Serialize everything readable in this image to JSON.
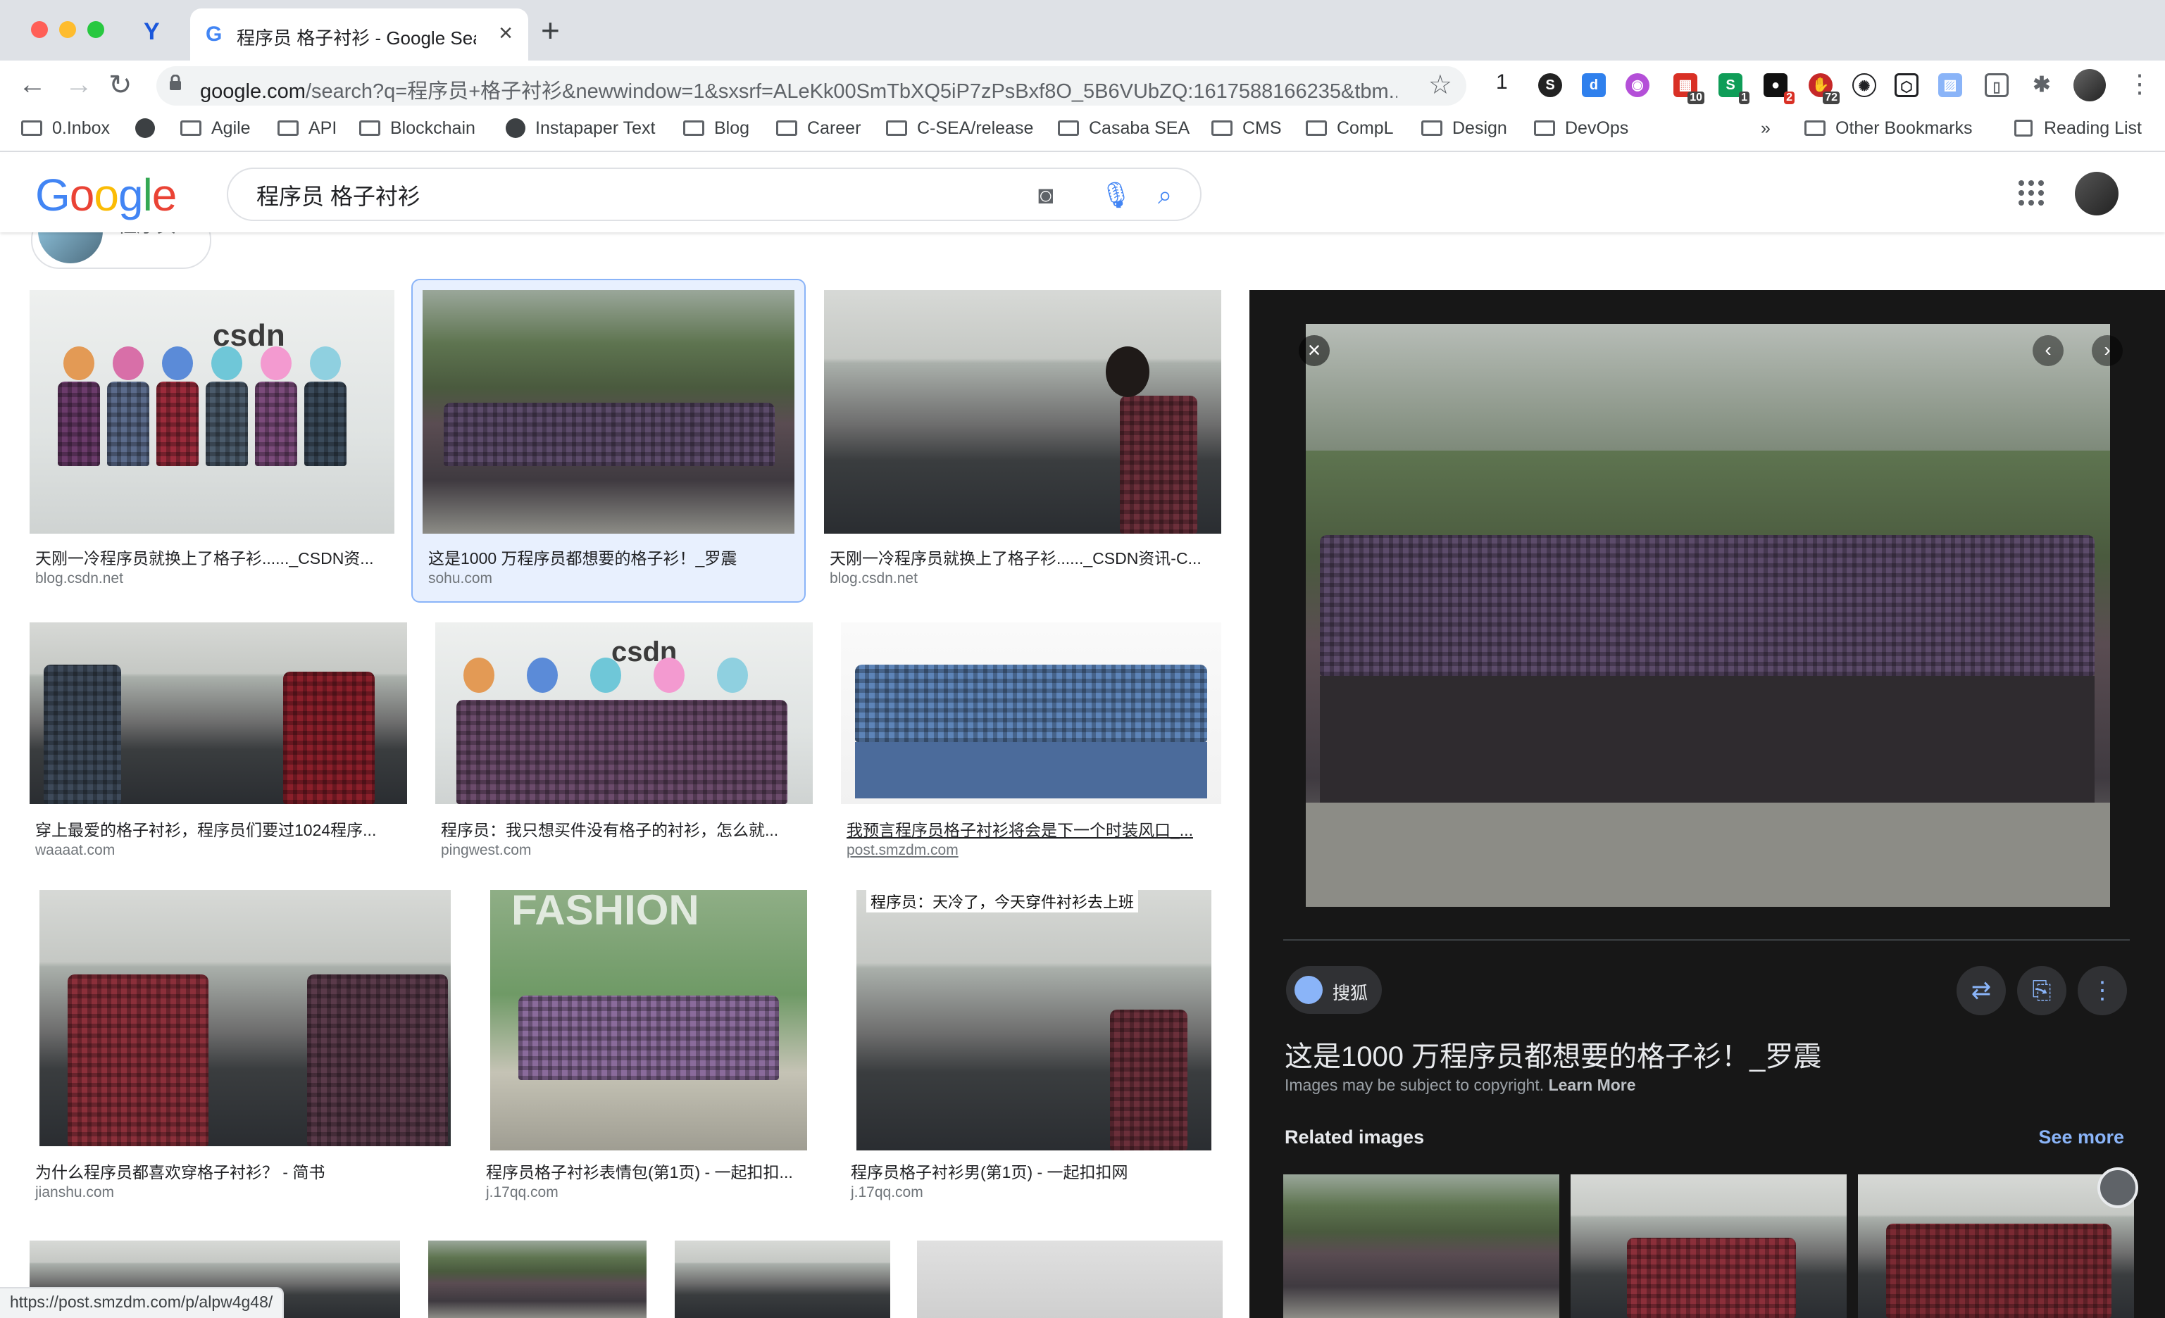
{
  "browser": {
    "tab_title": "程序员 格子衬衫 - Google Search",
    "url_host": "google.com",
    "url_rest": "/search?q=程序员+格子衬衫&newwindow=1&sxsrf=ALeKk00SmTbXQ5iP7zPsBxf8O_5B6VUbZQ:1617588166235&tbm...",
    "ext_count": "1",
    "ext_badges": [
      "10",
      "1",
      "2",
      "72"
    ]
  },
  "bookmarks": [
    "0.Inbox",
    "Agile",
    "API",
    "Blockchain",
    "Instapaper Text",
    "Blog",
    "Career",
    "C-SEA/release",
    "Casaba SEA",
    "CMS",
    "CompL",
    "Design",
    "DevOps"
  ],
  "bookmarks_overflow": "»",
  "other_bookmarks": "Other Bookmarks",
  "reading_list": "Reading List",
  "google": {
    "logo_letters": [
      "G",
      "o",
      "o",
      "g",
      "l",
      "e"
    ],
    "logo_colors": [
      "#4285f4",
      "#ea4335",
      "#fbbc05",
      "#4285f4",
      "#34a853",
      "#ea4335"
    ],
    "query": "程序员 格子衬衫",
    "chip_label": "程序员"
  },
  "results": [
    {
      "caption": "天刚一冷程序员就换上了格子衫......_CSDN资...",
      "source": "blog.csdn.net"
    },
    {
      "caption": "这是1000 万程序员都想要的格子衫！_罗震",
      "source": "sohu.com"
    },
    {
      "caption": "天刚一冷程序员就换上了格子衫......_CSDN资讯-C...",
      "source": "blog.csdn.net"
    },
    {
      "caption": "穿上最爱的格子衬衫，程序员们要过1024程序...",
      "source": "waaaat.com"
    },
    {
      "caption": "程序员：我只想买件没有格子的衬衫，怎么就...",
      "source": "pingwest.com"
    },
    {
      "caption": "我预言程序员格子衬衫将会是下一个时装风口_...",
      "source": "post.smzdm.com"
    },
    {
      "caption": "为什么程序员都喜欢穿格子衬衫？ - 简书",
      "source": "jianshu.com"
    },
    {
      "caption": "程序员格子衬衫表情包(第1页) - 一起扣扣...",
      "source": "j.17qq.com"
    },
    {
      "caption": "程序员格子衬衫男(第1页) - 一起扣扣网",
      "source": "j.17qq.com"
    }
  ],
  "thumb_overlays": {
    "csdn_logo": "csdn",
    "fashion": "FASHION",
    "meme_caption": "程序员：天冷了，今天穿件衬衫去上班"
  },
  "panel": {
    "source_name": "搜狐",
    "title": "这是1000 万程序员都想要的格子衫！_罗震",
    "copyright": "Images may be subject to copyright.",
    "learn_more": "Learn More",
    "related_heading": "Related images",
    "see_more": "See more"
  },
  "status_url": "https://post.smzdm.com/p/alpw4g48/"
}
